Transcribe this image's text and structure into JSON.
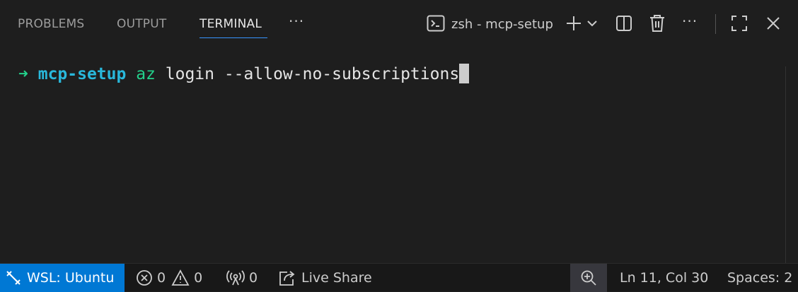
{
  "panel": {
    "tabs": [
      {
        "label": "PROBLEMS"
      },
      {
        "label": "OUTPUT"
      },
      {
        "label": "TERMINAL"
      }
    ],
    "more_label": "···",
    "terminal_name": "zsh - mcp-setup",
    "actions": [
      "new-terminal-icon",
      "launch-profile-chevron-icon",
      "split-terminal-icon",
      "kill-terminal-icon",
      "more-actions-icon",
      "maximize-panel-icon",
      "close-panel-icon"
    ]
  },
  "terminal": {
    "arrow": "➜",
    "cwd": "mcp-setup",
    "command": "az",
    "args": " login --allow-no-subscriptions"
  },
  "status": {
    "remote": "WSL: Ubuntu",
    "errors": "0",
    "warnings": "0",
    "ports": "0",
    "live_share": "Live Share",
    "position": "Ln 11, Col 30",
    "spaces": "Spaces: 2"
  },
  "colors": {
    "accent": "#0078d4",
    "prompt_green": "#23d18b",
    "prompt_cyan": "#29b8db"
  }
}
